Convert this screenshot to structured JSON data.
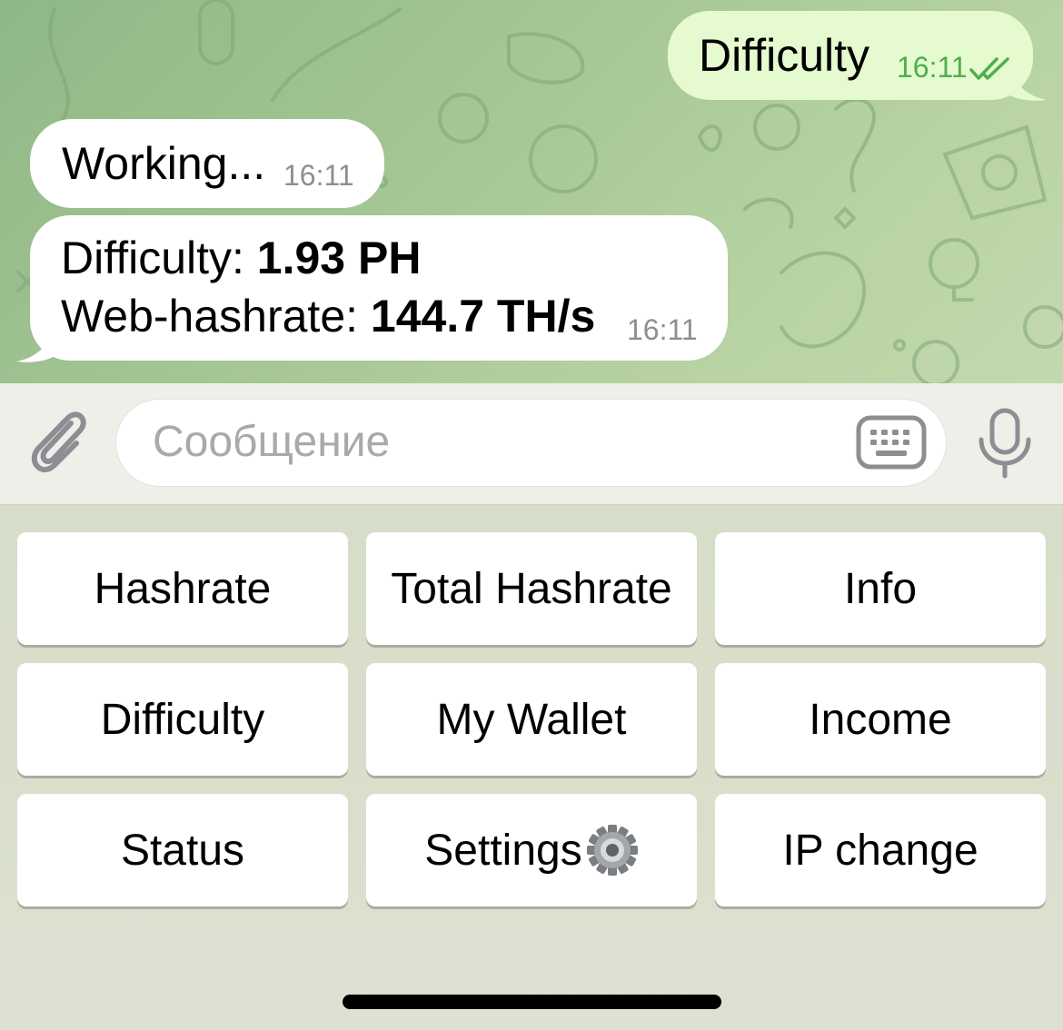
{
  "chat": {
    "outgoing": {
      "text": "Difficulty",
      "time": "16:11"
    },
    "incoming_working": {
      "text": "Working...",
      "time": "16:11"
    },
    "incoming_result": {
      "line1_label": "Difficulty: ",
      "line1_value": "1.93 PH",
      "line2_label": "Web-hashrate: ",
      "line2_value": "144.7 TH/s",
      "time": "16:11"
    }
  },
  "input": {
    "placeholder": "Сообщение"
  },
  "keyboard": {
    "row1": [
      "Hashrate",
      "Total Hashrate",
      "Info"
    ],
    "row2": [
      "Difficulty",
      "My Wallet",
      "Income"
    ],
    "row3": [
      "Status",
      "Settings",
      "IP change"
    ]
  },
  "colors": {
    "outgoing_bubble": "#e5fbcf",
    "read_check": "#4fae4e",
    "chat_bg": "#a7c796"
  }
}
